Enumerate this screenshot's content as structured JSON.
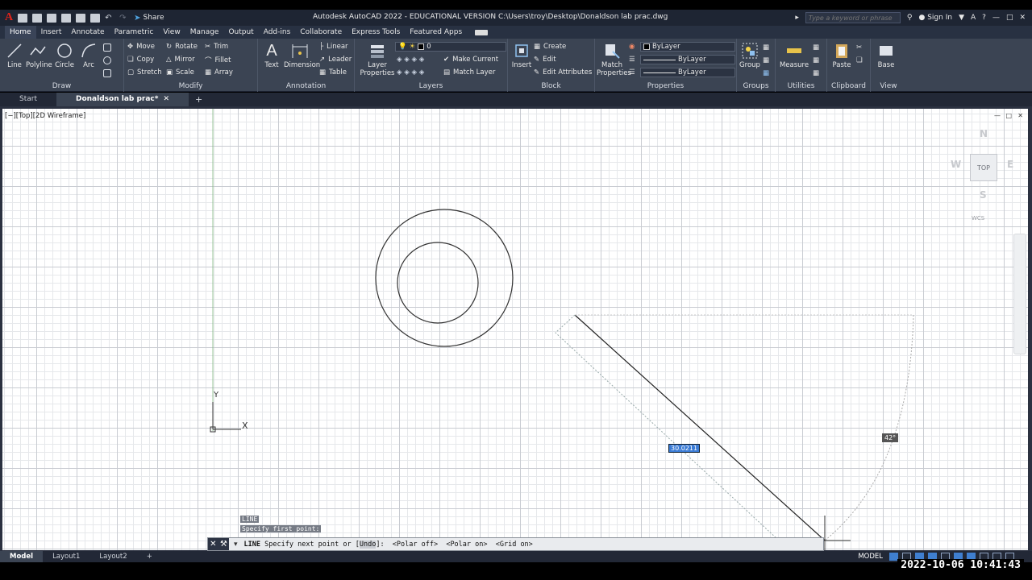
{
  "app": {
    "logo": "A",
    "share_label": "Share",
    "title": "Autodesk AutoCAD 2022 - EDUCATIONAL VERSION    C:\\Users\\troy\\Desktop\\Donaldson  lab prac.dwg",
    "search_placeholder": "Type a keyword or phrase",
    "sign_in": "Sign In"
  },
  "ribbon_tabs": [
    "Home",
    "Insert",
    "Annotate",
    "Parametric",
    "View",
    "Manage",
    "Output",
    "Add-ins",
    "Collaborate",
    "Express Tools",
    "Featured Apps"
  ],
  "ribbon": {
    "draw": {
      "title": "Draw",
      "line": "Line",
      "polyline": "Polyline",
      "circle": "Circle",
      "arc": "Arc"
    },
    "modify": {
      "title": "Modify",
      "move": "Move",
      "rotate": "Rotate",
      "trim": "Trim",
      "copy": "Copy",
      "mirror": "Mirror",
      "fillet": "Fillet",
      "stretch": "Stretch",
      "scale": "Scale",
      "array": "Array"
    },
    "annotation": {
      "title": "Annotation",
      "text": "Text",
      "dimension": "Dimension",
      "linear": "Linear",
      "leader": "Leader",
      "table": "Table"
    },
    "layers": {
      "title": "Layers",
      "layer_properties": "Layer Properties",
      "current_layer": "0",
      "make_current": "Make Current",
      "match_layer": "Match Layer"
    },
    "block": {
      "title": "Block",
      "insert": "Insert",
      "create": "Create",
      "edit": "Edit",
      "edit_attributes": "Edit Attributes"
    },
    "properties": {
      "title": "Properties",
      "match_properties": "Match Properties",
      "color": "ByLayer",
      "linetype": "ByLayer",
      "lineweight": "ByLayer"
    },
    "groups": {
      "title": "Groups",
      "group": "Group"
    },
    "utilities": {
      "title": "Utilities",
      "measure": "Measure"
    },
    "clipboard": {
      "title": "Clipboard",
      "paste": "Paste"
    },
    "view": {
      "title": "View",
      "base": "Base"
    }
  },
  "doc_tabs": {
    "start": "Start",
    "active": "Donaldson  lab prac*"
  },
  "viewport": {
    "label": "[−][Top][2D Wireframe]",
    "viewcube": {
      "n": "N",
      "s": "S",
      "e": "E",
      "w": "W",
      "face": "TOP",
      "wcs": "WCS"
    },
    "ucs_x": "X",
    "ucs_y": "Y",
    "dim_input": "30.0211",
    "angle_tip": "42°"
  },
  "command": {
    "history": [
      "LINE",
      "Specify first point:"
    ],
    "prefix": "LINE",
    "prompt": "Specify next point or [",
    "undo": "Undo",
    "suffix": "]:  <Polar off>  <Polar on>  <Grid on>"
  },
  "layout_tabs": [
    "Model",
    "Layout1",
    "Layout2"
  ],
  "status": {
    "model": "MODEL"
  },
  "timestamp": "2022-10-06  10:41:43",
  "colors": {
    "ribbon_bg": "#3b4453",
    "title_bg": "#1e2533",
    "canvas_bg": "#ffffff",
    "accent": "#3a7bd5",
    "logo": "#e2231a"
  }
}
